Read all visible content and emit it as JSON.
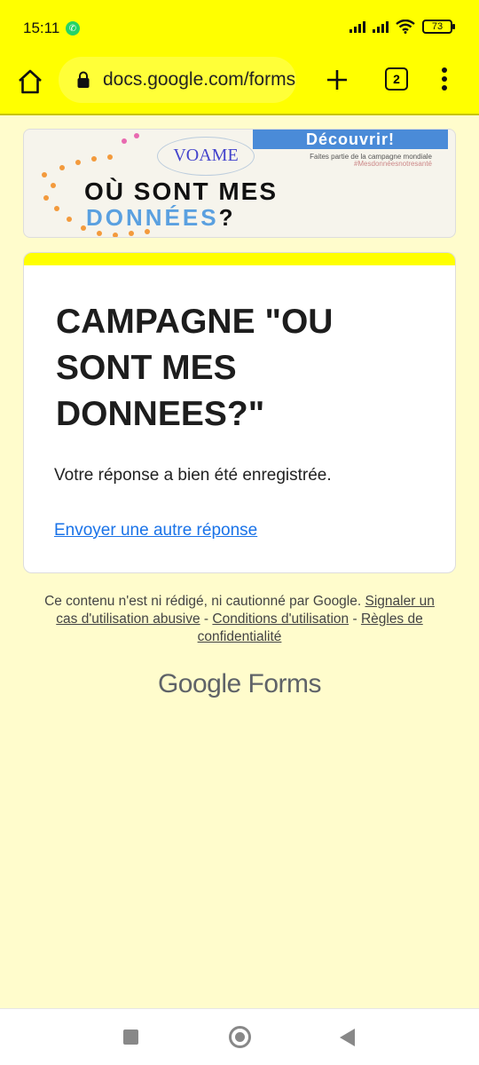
{
  "status_bar": {
    "time": "15:11",
    "battery": "73"
  },
  "browser": {
    "url": "docs.google.com/forms",
    "tab_count": "2"
  },
  "banner": {
    "badge": "Découvrir!",
    "logo_text": "VOAME",
    "subline": "Faites partie de la campagne mondiale",
    "hashtag": "#Mesdonnéesnotresanté",
    "title_line1": "OÙ SONT MES",
    "title_line2_a": "DONNÉES",
    "title_line2_b": "?"
  },
  "card": {
    "title": "CAMPAGNE \"OU SONT MES DONNEES?\"",
    "message": "Votre réponse a bien été enregistrée.",
    "link": "Envoyer une autre réponse"
  },
  "footer": {
    "disclaimer": "Ce contenu n'est ni rédigé, ni cautionné par Google.",
    "report_link": "Signaler un cas d'utilisation abusive",
    "sep1": " - ",
    "terms_link": "Conditions d'utilisation",
    "sep2": " - ",
    "privacy_link": "Règles de confidentialité",
    "brand_google": "Google",
    "brand_forms": "Forms"
  },
  "colors": {
    "accent": "#ffff00",
    "background": "#fffccc",
    "link": "#1a73e8"
  }
}
